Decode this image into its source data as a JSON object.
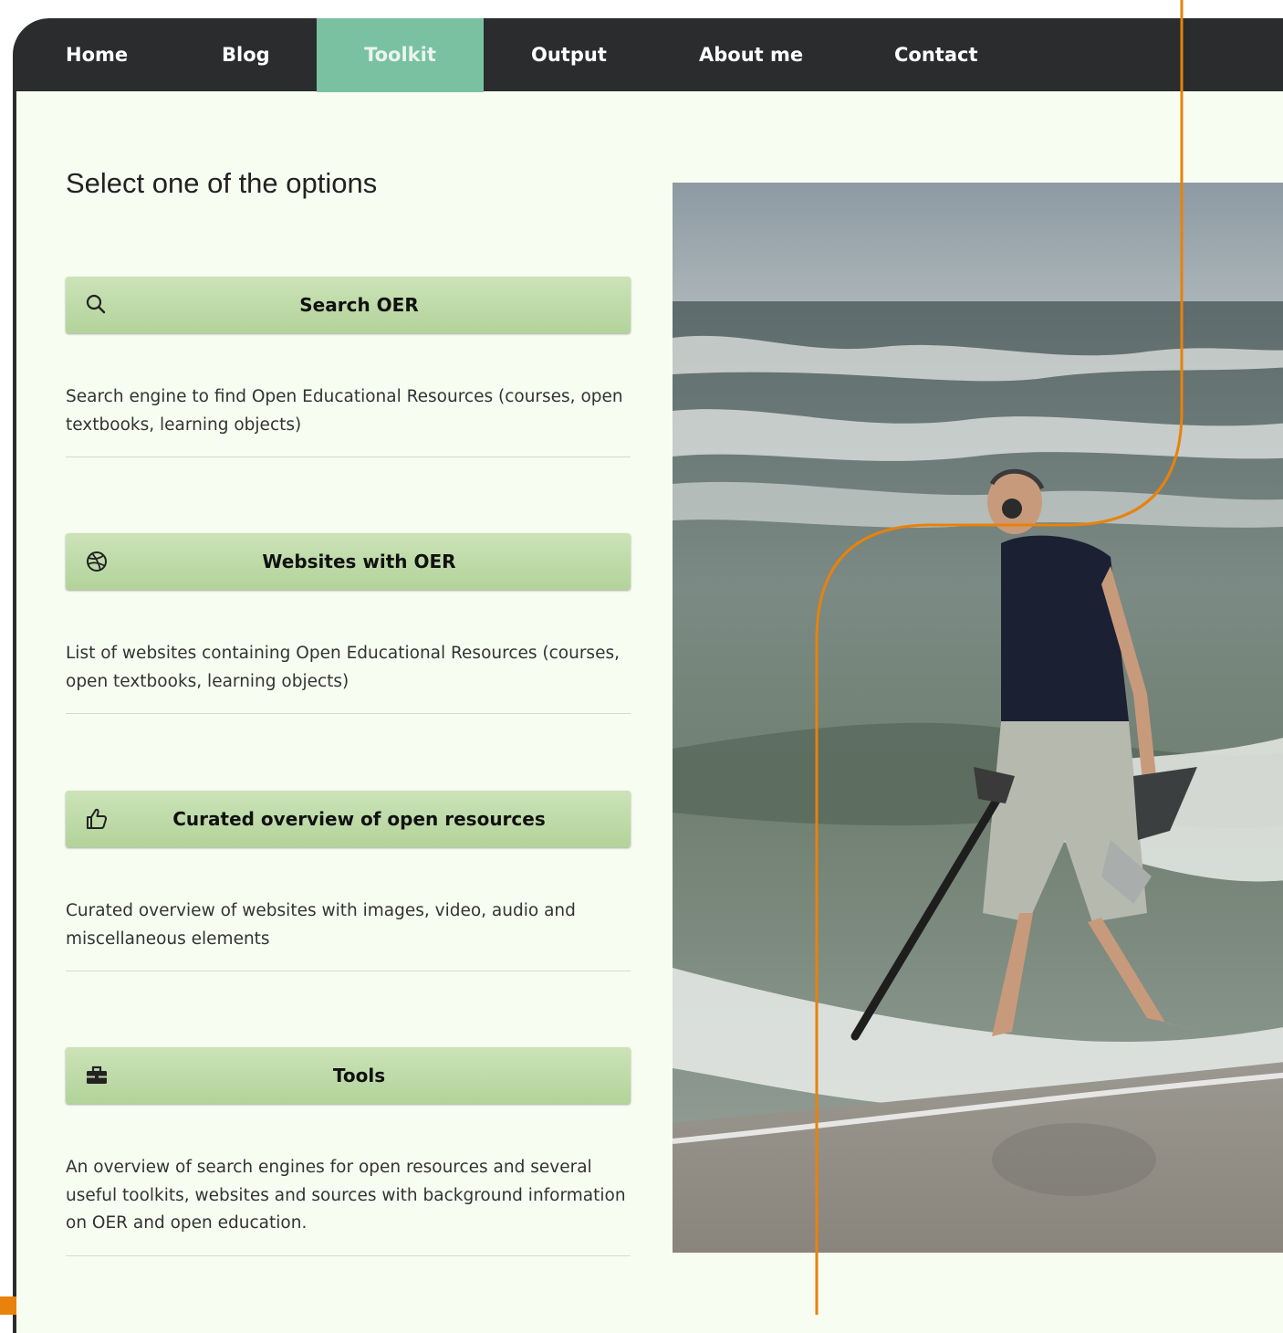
{
  "nav": {
    "items": [
      {
        "label": "Home"
      },
      {
        "label": "Blog"
      },
      {
        "label": "Toolkit",
        "active": true
      },
      {
        "label": "Output"
      },
      {
        "label": "About me"
      },
      {
        "label": "Contact"
      }
    ]
  },
  "main": {
    "title": "Select one of the options",
    "options": [
      {
        "icon": "search-icon",
        "label": "Search OER",
        "description": "Search engine to find Open Educational Resources (courses, open textbooks, learning objects)"
      },
      {
        "icon": "dribbble-icon",
        "label": "Websites with OER",
        "description": "List of websites containing Open Educational Resources (courses, open textbooks, learning objects)"
      },
      {
        "icon": "thumbs-up-icon",
        "label": "Curated overview of open resources",
        "description": "Curated overview of websites with images, video, audio and miscellaneous elements"
      },
      {
        "icon": "toolbox-icon",
        "label": "Tools",
        "description": "An overview of search engines for open resources and several useful toolkits, websites and sources with background information on OER and open education."
      }
    ]
  },
  "photo": {
    "subject": "beach-metal-detector-photo"
  },
  "colors": {
    "nav_background": "#2b2c2e",
    "nav_active": "#79c1a1",
    "page_background": "#f8fdf1",
    "button_gradient_top": "#cce3b8",
    "button_gradient_bottom": "#b2d39a",
    "accent_orange": "#e8820c"
  }
}
